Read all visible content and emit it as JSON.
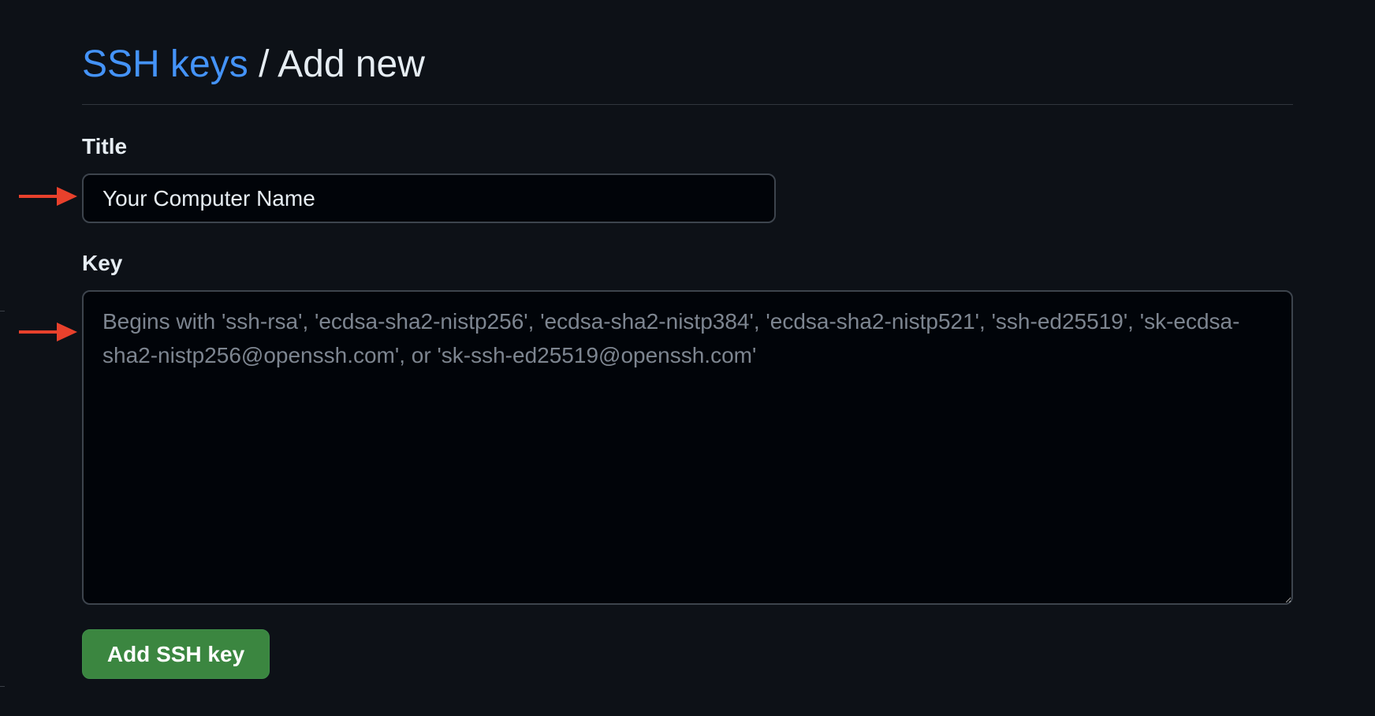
{
  "header": {
    "breadcrumb_link": "SSH keys",
    "separator": "/",
    "current": "Add new"
  },
  "form": {
    "title_label": "Title",
    "title_value": "Your Computer Name",
    "key_label": "Key",
    "key_placeholder": "Begins with 'ssh-rsa', 'ecdsa-sha2-nistp256', 'ecdsa-sha2-nistp384', 'ecdsa-sha2-nistp521', 'ssh-ed25519', 'sk-ecdsa-sha2-nistp256@openssh.com', or 'sk-ssh-ed25519@openssh.com'",
    "submit_label": "Add SSH key"
  },
  "annotations": {
    "arrow_color": "#e8412c"
  },
  "colors": {
    "background": "#0d1117",
    "link": "#4493f8",
    "button": "#3b8640"
  }
}
